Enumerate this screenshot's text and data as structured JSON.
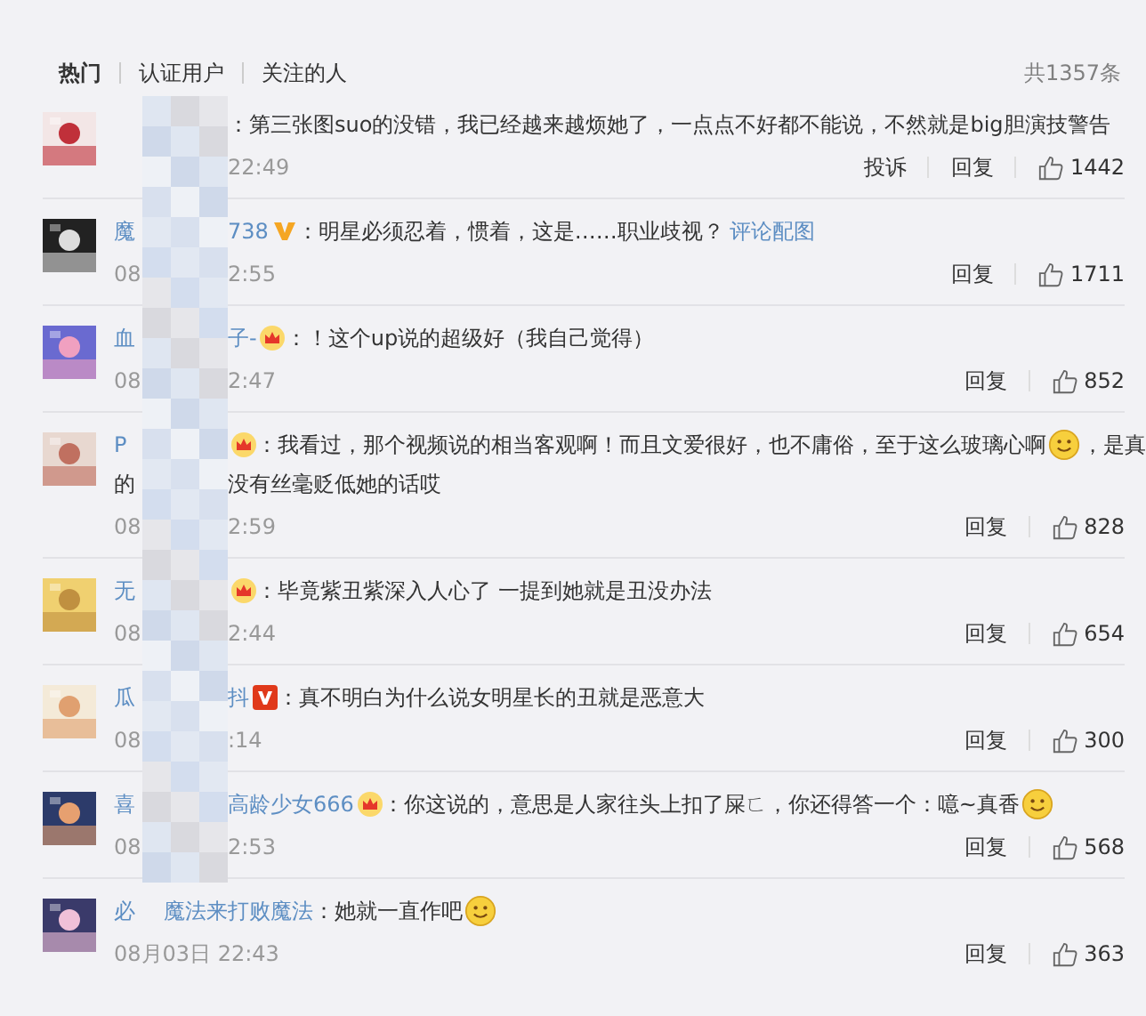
{
  "tabs": [
    {
      "label": "热门",
      "selected": true
    },
    {
      "label": "认证用户",
      "selected": false
    },
    {
      "label": "关注的人",
      "selected": false
    }
  ],
  "total": "共1357条",
  "comments": [
    {
      "colon": "：",
      "lines": [
        {
          "segments": [
            {
              "kind": "text",
              "value": "第三张图suo的没错，我已经越来越烦她了，一点点不好都不能说，不然就是big胆演技警告"
            }
          ]
        }
      ],
      "date_end": "22:49",
      "actions": [
        "投诉",
        "回复"
      ],
      "likes": "1442"
    },
    {
      "name_start": "魔",
      "name_end": "738",
      "badge": {
        "kind": "gold-v"
      },
      "colon": "：",
      "lines": [
        {
          "segments": [
            {
              "kind": "text",
              "value": "明星必须忍着，惯着，这是……职业歧视？"
            },
            {
              "kind": "link",
              "value": "评论配图"
            }
          ]
        }
      ],
      "date_start": "08",
      "date_end": "2:55",
      "actions": [
        "回复"
      ],
      "likes": "1711"
    },
    {
      "name_start": "血",
      "name_end": "子-",
      "badge": {
        "kind": "crown"
      },
      "colon": "：",
      "lines": [
        {
          "segments": [
            {
              "kind": "text",
              "value": "！这个up说的超级好（我自己觉得）"
            }
          ]
        }
      ],
      "date_start": "08",
      "date_end": "2:47",
      "actions": [
        "回复"
      ],
      "likes": "852"
    },
    {
      "name_start": "P",
      "badge": {
        "kind": "crown"
      },
      "colon": "：",
      "lines": [
        {
          "segments": [
            {
              "kind": "text",
              "value": "我看过，那个视频说的相当客观啊！而且文爱很好，也不庸俗，至于这么玻璃心啊"
            },
            {
              "kind": "emoji"
            },
            {
              "kind": "text",
              "value": "，是真"
            }
          ]
        },
        {
          "lead": "的",
          "segments": [
            {
              "kind": "text",
              "value": "没有丝毫贬低她的话哎"
            }
          ]
        }
      ],
      "date_start": "08",
      "date_end": "2:59",
      "actions": [
        "回复"
      ],
      "likes": "828"
    },
    {
      "name_start": "无",
      "badge": {
        "kind": "crown"
      },
      "colon": "：",
      "lines": [
        {
          "segments": [
            {
              "kind": "text",
              "value": "毕竟紫丑紫深入人心了 一提到她就是丑没办法"
            }
          ]
        }
      ],
      "date_start": "08",
      "date_end": "2:44",
      "actions": [
        "回复"
      ],
      "likes": "654"
    },
    {
      "name_start": "瓜",
      "name_end": "抖",
      "badge": {
        "kind": "red-v"
      },
      "colon": "：",
      "lines": [
        {
          "segments": [
            {
              "kind": "text",
              "value": "真不明白为什么说女明星长的丑就是恶意大"
            }
          ]
        }
      ],
      "date_start": "08",
      "date_end": ":14",
      "actions": [
        "回复"
      ],
      "likes": "300"
    },
    {
      "name_start": "喜",
      "name_end": "高龄少女666",
      "badge": {
        "kind": "crown"
      },
      "colon": "：",
      "lines": [
        {
          "segments": [
            {
              "kind": "text",
              "value": "你这说的，意思是人家往头上扣了屎ㄈ，你还得答一个：噫~真香"
            },
            {
              "kind": "emoji"
            }
          ]
        }
      ],
      "date_start": "08",
      "date_end": "2:53",
      "actions": [
        "回复"
      ],
      "likes": "568"
    },
    {
      "name_start": "必",
      "name_end": "魔法来打败魔法",
      "colon": "：",
      "lines": [
        {
          "segments": [
            {
              "kind": "text",
              "value": "她就一直作吧"
            },
            {
              "kind": "emoji"
            }
          ]
        }
      ],
      "date": "08月03日 22:43",
      "actions": [
        "回复"
      ],
      "likes": "363"
    }
  ]
}
